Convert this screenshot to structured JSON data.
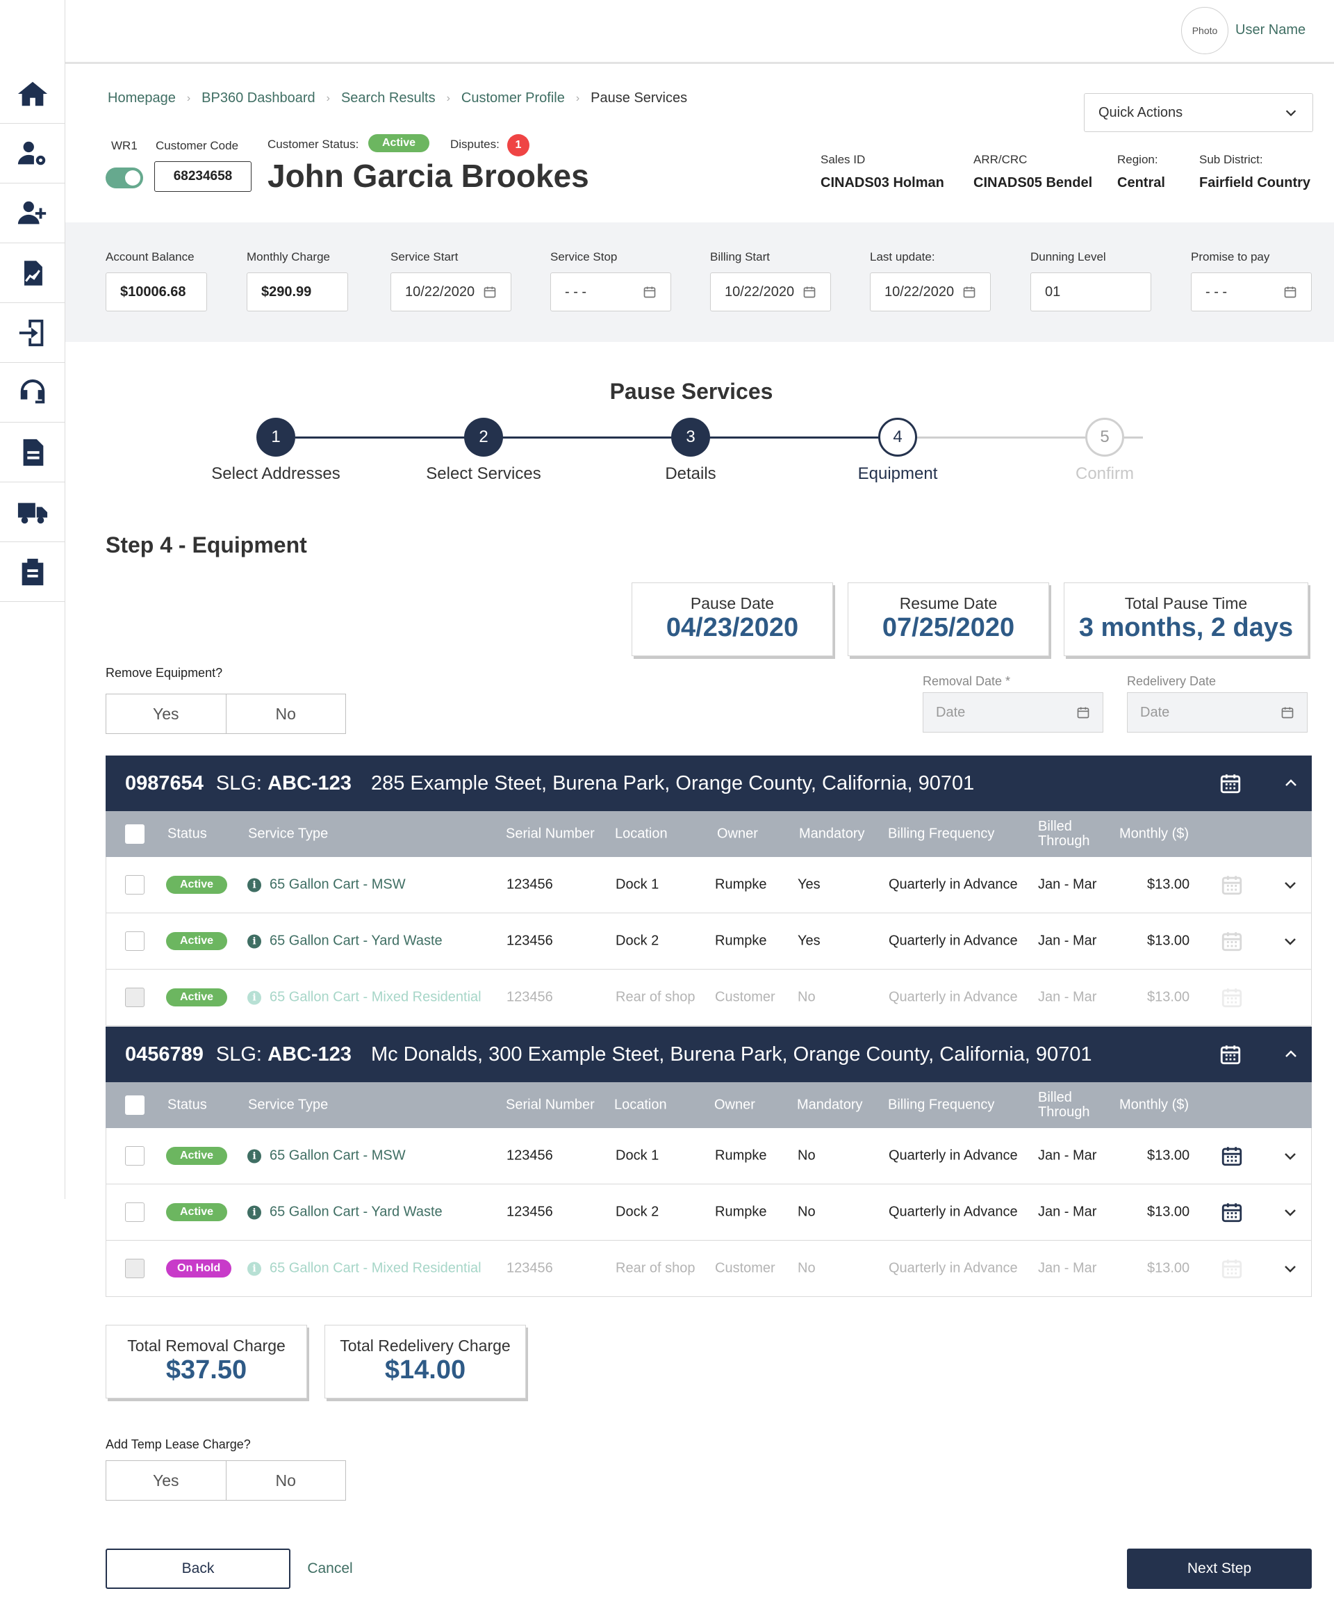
{
  "header": {
    "avatar_text": "Photo",
    "user_name": "User Name"
  },
  "sidebar": {
    "items": [
      {
        "icon": "home-icon"
      },
      {
        "icon": "user-settings-icon"
      },
      {
        "icon": "add-user-icon"
      },
      {
        "icon": "document-chart-icon"
      },
      {
        "icon": "sign-in-icon"
      },
      {
        "icon": "headset-icon"
      },
      {
        "icon": "document-icon"
      },
      {
        "icon": "truck-icon"
      },
      {
        "icon": "clipboard-icon"
      }
    ]
  },
  "breadcrumb": [
    "Homepage",
    "BP360 Dashboard",
    "Search Results",
    "Customer Profile",
    "Pause Services"
  ],
  "quick_actions": "Quick Actions",
  "customer": {
    "wr_label": "WR1",
    "code_label": "Customer Code",
    "code": "68234658",
    "status_label": "Customer Status:",
    "status": "Active",
    "disputes_label": "Disputes:",
    "disputes": "1",
    "name": "John Garcia Brookes",
    "meta": [
      {
        "label": "Sales ID",
        "value": "CINADS03 Holman"
      },
      {
        "label": "ARR/CRC",
        "value": "CINADS05 Bendel"
      },
      {
        "label": "Region:",
        "value": "Central"
      },
      {
        "label": "Sub District:",
        "value": "Fairfield Country"
      }
    ]
  },
  "account": [
    {
      "label": "Account Balance",
      "value": "$10006.68"
    },
    {
      "label": "Monthly Charge",
      "value": "$290.99"
    },
    {
      "label": "Service Start",
      "value": "10/22/2020"
    },
    {
      "label": "Service Stop",
      "value": "- - -"
    },
    {
      "label": "Billing Start",
      "value": "10/22/2020"
    },
    {
      "label": "Last update:",
      "value": "10/22/2020"
    },
    {
      "label": "Dunning Level",
      "value": "01"
    },
    {
      "label": "Promise to pay",
      "value": "- - -"
    }
  ],
  "stepper": {
    "title": "Pause Services",
    "steps": [
      {
        "num": "1",
        "label": "Select Addresses"
      },
      {
        "num": "2",
        "label": "Select Services"
      },
      {
        "num": "3",
        "label": "Details"
      },
      {
        "num": "4",
        "label": "Equipment"
      },
      {
        "num": "5",
        "label": "Confirm"
      }
    ]
  },
  "step_title": "Step 4 - Equipment",
  "summary": [
    {
      "label": "Pause Date",
      "value": "04/23/2020"
    },
    {
      "label": "Resume Date",
      "value": "07/25/2020"
    },
    {
      "label": "Total Pause Time",
      "value": "3 months, 2 days"
    }
  ],
  "remove_equipment": {
    "question": "Remove Equipment?",
    "yes": "Yes",
    "no": "No",
    "removal_label": "Removal Date *",
    "redelivery_label": "Redelivery Date",
    "date_placeholder": "Date"
  },
  "columns": [
    "Status",
    "Service Type",
    "Serial Number",
    "Location",
    "Owner",
    "Mandatory",
    "Billing Frequency",
    "Billed Through",
    "Monthly ($)"
  ],
  "groups": [
    {
      "num": "0987654",
      "slg_label": "SLG:",
      "slg": "ABC-123",
      "address": "285 Example Steet, Burena Park, Orange County, California, 90701",
      "rows": [
        {
          "status": "Active",
          "service": "65 Gallon Cart - MSW",
          "serial": "123456",
          "location": "Dock 1",
          "owner": "Rumpke",
          "mandatory": "Yes",
          "freq": "Quarterly in Advance",
          "billed": "Jan - Mar",
          "monthly": "$13.00"
        },
        {
          "status": "Active",
          "service": "65 Gallon Cart - Yard Waste",
          "serial": "123456",
          "location": "Dock 2",
          "owner": "Rumpke",
          "mandatory": "Yes",
          "freq": "Quarterly in Advance",
          "billed": "Jan - Mar",
          "monthly": "$13.00"
        },
        {
          "status": "Active",
          "service": "65 Gallon Cart - Mixed Residential",
          "serial": "123456",
          "location": "Rear of shop",
          "owner": "Customer",
          "mandatory": "No",
          "freq": "Quarterly in Advance",
          "billed": "Jan - Mar",
          "monthly": "$13.00"
        }
      ]
    },
    {
      "num": "0456789",
      "slg_label": "SLG:",
      "slg": "ABC-123",
      "address": "Mc Donalds, 300 Example Steet, Burena Park, Orange County, California, 90701",
      "rows": [
        {
          "status": "Active",
          "service": "65 Gallon Cart - MSW",
          "serial": "123456",
          "location": "Dock 1",
          "owner": "Rumpke",
          "mandatory": "No",
          "freq": "Quarterly in Advance",
          "billed": "Jan - Mar",
          "monthly": "$13.00"
        },
        {
          "status": "Active",
          "service": "65 Gallon Cart - Yard Waste",
          "serial": "123456",
          "location": "Dock 2",
          "owner": "Rumpke",
          "mandatory": "No",
          "freq": "Quarterly in Advance",
          "billed": "Jan - Mar",
          "monthly": "$13.00"
        },
        {
          "status": "On Hold",
          "service": "65 Gallon Cart - Mixed Residential",
          "serial": "123456",
          "location": "Rear of shop",
          "owner": "Customer",
          "mandatory": "No",
          "freq": "Quarterly in Advance",
          "billed": "Jan - Mar",
          "monthly": "$13.00"
        }
      ]
    }
  ],
  "totals": [
    {
      "label": "Total Removal Charge",
      "value": "$37.50"
    },
    {
      "label": "Total Redelivery Charge",
      "value": "$14.00"
    }
  ],
  "temp_lease": {
    "question": "Add Temp Lease Charge?",
    "yes": "Yes",
    "no": "No"
  },
  "footer": {
    "back": "Back",
    "cancel": "Cancel",
    "next": "Next Step"
  },
  "colors": {
    "navy": "#24324d",
    "accent_green": "#3f6e63",
    "active": "#6cb660",
    "on_hold": "#c83bc9",
    "value_blue": "#2e5a86"
  }
}
